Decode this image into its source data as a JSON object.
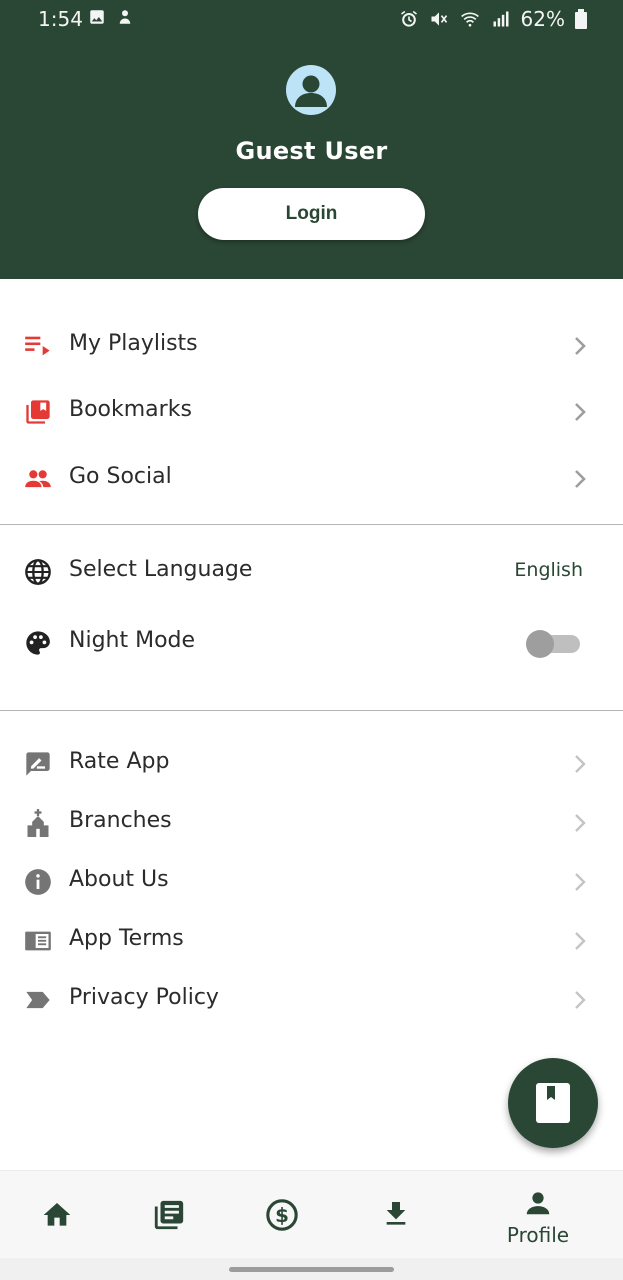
{
  "status_bar": {
    "time": "1:54",
    "battery": "62%"
  },
  "header": {
    "username": "Guest User",
    "login_label": "Login"
  },
  "menu_group_1": [
    {
      "label": "My Playlists",
      "icon": "playlist-icon"
    },
    {
      "label": "Bookmarks",
      "icon": "bookmarks-icon"
    },
    {
      "label": "Go Social",
      "icon": "people-icon"
    }
  ],
  "settings": {
    "language_label": "Select Language",
    "language_value": "English",
    "night_mode_label": "Night Mode",
    "night_mode_enabled": false
  },
  "menu_group_2": [
    {
      "label": "Rate App",
      "icon": "rate-review-icon"
    },
    {
      "label": "Branches",
      "icon": "church-icon"
    },
    {
      "label": "About Us",
      "icon": "info-icon"
    },
    {
      "label": "App Terms",
      "icon": "terms-icon"
    },
    {
      "label": "Privacy Policy",
      "icon": "label-icon"
    }
  ],
  "bottom_nav": {
    "items": [
      {
        "icon": "home-icon",
        "label": ""
      },
      {
        "icon": "library-books-icon",
        "label": ""
      },
      {
        "icon": "dollar-icon",
        "label": ""
      },
      {
        "icon": "download-icon",
        "label": ""
      },
      {
        "icon": "person-icon",
        "label": "Profile"
      }
    ],
    "active_index": 4
  },
  "colors": {
    "primary": "#2a4634",
    "accent": "#e53935",
    "muted": "#757575",
    "chevron": "#9e9e9e"
  }
}
